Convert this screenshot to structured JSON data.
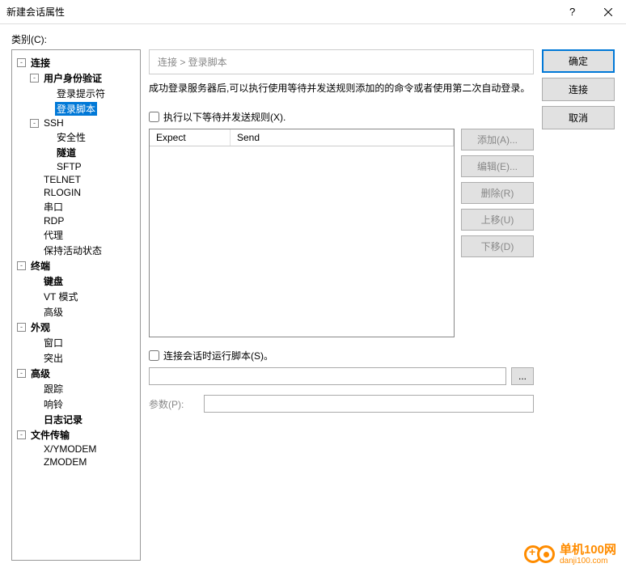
{
  "titlebar": {
    "title": "新建会话属性"
  },
  "category_label": "类别(C):",
  "tree": [
    {
      "label": "连接",
      "bold": true,
      "indent": 0,
      "toggle": "-"
    },
    {
      "label": "用户身份验证",
      "bold": true,
      "indent": 1,
      "toggle": "-"
    },
    {
      "label": "登录提示符",
      "indent": 2
    },
    {
      "label": "登录脚本",
      "indent": 2,
      "selected": true
    },
    {
      "label": "SSH",
      "indent": 1,
      "toggle": "-"
    },
    {
      "label": "安全性",
      "indent": 2
    },
    {
      "label": "隧道",
      "bold": true,
      "indent": 2
    },
    {
      "label": "SFTP",
      "indent": 2
    },
    {
      "label": "TELNET",
      "indent": 1
    },
    {
      "label": "RLOGIN",
      "indent": 1
    },
    {
      "label": "串口",
      "indent": 1
    },
    {
      "label": "RDP",
      "indent": 1
    },
    {
      "label": "代理",
      "indent": 1
    },
    {
      "label": "保持活动状态",
      "indent": 1
    },
    {
      "label": "终端",
      "bold": true,
      "indent": 0,
      "toggle": "-"
    },
    {
      "label": "键盘",
      "bold": true,
      "indent": 1
    },
    {
      "label": "VT 模式",
      "indent": 1
    },
    {
      "label": "高级",
      "indent": 1
    },
    {
      "label": "外观",
      "bold": true,
      "indent": 0,
      "toggle": "-"
    },
    {
      "label": "窗口",
      "indent": 1
    },
    {
      "label": "突出",
      "indent": 1
    },
    {
      "label": "高级",
      "bold": true,
      "indent": 0,
      "toggle": "-"
    },
    {
      "label": "跟踪",
      "indent": 1
    },
    {
      "label": "响铃",
      "indent": 1
    },
    {
      "label": "日志记录",
      "bold": true,
      "indent": 1
    },
    {
      "label": "文件传输",
      "bold": true,
      "indent": 0,
      "toggle": "-"
    },
    {
      "label": "X/YMODEM",
      "indent": 1
    },
    {
      "label": "ZMODEM",
      "indent": 1
    }
  ],
  "breadcrumb": "连接 > 登录脚本",
  "description": "成功登录服务器后,可以执行使用等待并发送规则添加的的命令或者使用第二次自动登录。",
  "checkbox_rules": "执行以下等待并发送规则(X).",
  "table": {
    "col_expect": "Expect",
    "col_send": "Send"
  },
  "rule_buttons": {
    "add": "添加(A)...",
    "edit": "编辑(E)...",
    "delete": "删除(R)",
    "up": "上移(U)",
    "down": "下移(D)"
  },
  "checkbox_script": "连接会话时运行脚本(S)。",
  "browse_icon": "...",
  "params_label": "参数(P):",
  "dialog_buttons": {
    "ok": "确定",
    "connect": "连接",
    "cancel": "取消"
  },
  "watermark": {
    "cn": "单机100网",
    "en": "danji100.com"
  }
}
